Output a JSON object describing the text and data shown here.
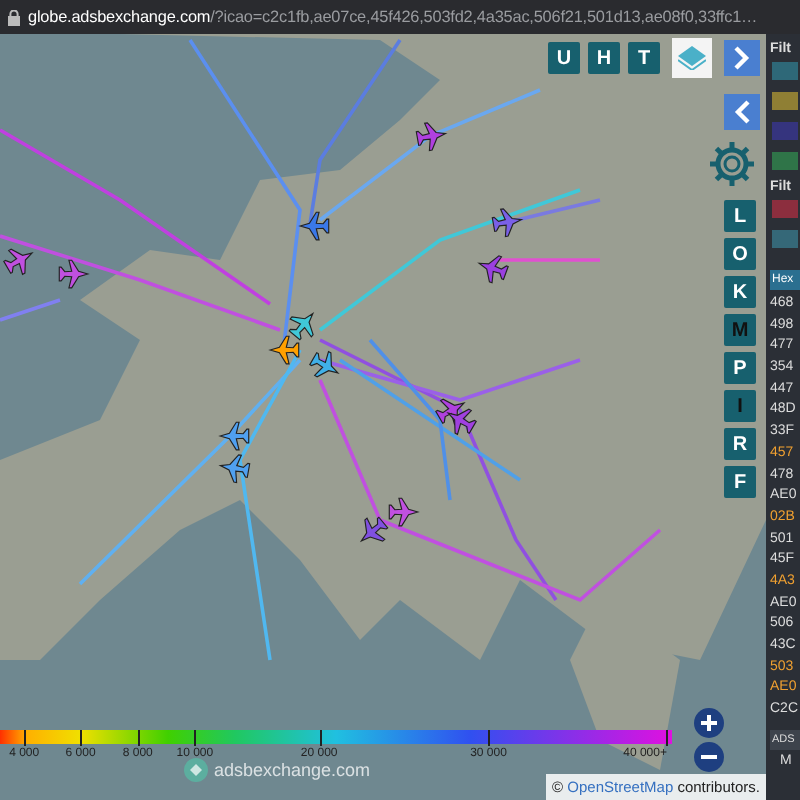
{
  "browser": {
    "host": "globe.adsbexchange.com",
    "path": "/?icao=c2c1fb,ae07ce,45f426,503fd2,4a35ac,506f21,501d13,ae08f0,33ffc1…"
  },
  "top_buttons": [
    {
      "label": "U",
      "active": false
    },
    {
      "label": "H",
      "active": false
    },
    {
      "label": "T",
      "active": false
    }
  ],
  "side_buttons": [
    {
      "label": "L",
      "active": false
    },
    {
      "label": "O",
      "active": false
    },
    {
      "label": "K",
      "active": false
    },
    {
      "label": "M",
      "active": true
    },
    {
      "label": "P",
      "active": false
    },
    {
      "label": "I",
      "active": true
    },
    {
      "label": "R",
      "active": false
    },
    {
      "label": "F",
      "active": false
    }
  ],
  "altitude_legend": {
    "ticks": [
      {
        "label": "4 000",
        "level": 0.036
      },
      {
        "label": "6 000",
        "level": 0.12
      },
      {
        "label": "8 000",
        "level": 0.205
      },
      {
        "label": "10 000",
        "level": 0.29
      },
      {
        "label": "20 000",
        "level": 0.475
      },
      {
        "label": "30 000",
        "level": 0.727
      },
      {
        "label": "40 000+",
        "level": 0.99
      }
    ]
  },
  "logo": "adsbexchange.com",
  "attribution": {
    "symbol": "©",
    "link": "OpenStreetMap",
    "text": "contributors."
  },
  "sidebar": {
    "filter_groups": [
      {
        "label": "Filt",
        "swatches": [
          {
            "color": "#2e6878"
          },
          {
            "color": "#8f7f34"
          },
          {
            "color": "#35347e"
          },
          {
            "color": "#2f7448"
          }
        ]
      },
      {
        "label": "Filt",
        "swatches": [
          {
            "color": "#8c2e3e"
          },
          {
            "color": "#356878"
          }
        ]
      }
    ],
    "column_header": "Hex",
    "rows": [
      {
        "hex": "468",
        "highlighted": false
      },
      {
        "hex": "498",
        "highlighted": false
      },
      {
        "hex": "477",
        "highlighted": false
      },
      {
        "hex": "354",
        "highlighted": false
      },
      {
        "hex": "447",
        "highlighted": false
      },
      {
        "hex": "48D",
        "highlighted": false
      },
      {
        "hex": "33F",
        "highlighted": false
      },
      {
        "hex": "457",
        "highlighted": true
      },
      {
        "hex": "478",
        "highlighted": false
      },
      {
        "hex": "AE0",
        "highlighted": false
      },
      {
        "hex": "02B",
        "highlighted": true
      },
      {
        "hex": "501",
        "highlighted": false
      },
      {
        "hex": "45F",
        "highlighted": false
      },
      {
        "hex": "4A3",
        "highlighted": true
      },
      {
        "hex": "AE0",
        "highlighted": false
      },
      {
        "hex": "506",
        "highlighted": false
      },
      {
        "hex": "43C",
        "highlighted": false
      },
      {
        "hex": "503",
        "highlighted": true
      },
      {
        "hex": "AE0",
        "highlighted": true
      },
      {
        "hex": "C2C",
        "highlighted": false
      }
    ],
    "button": "ADS",
    "footer": "M"
  }
}
